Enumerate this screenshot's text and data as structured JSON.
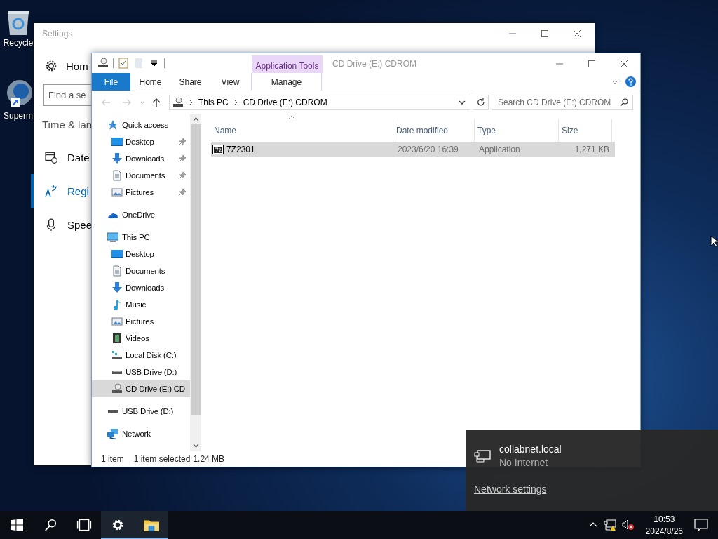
{
  "desktop_icons": [
    {
      "label": "Recycle",
      "kind": "recycle"
    },
    {
      "label": "Superm",
      "kind": "app"
    }
  ],
  "settings": {
    "title": "Settings",
    "home": "Hom",
    "search": {
      "placeholder": "Find a se"
    },
    "section": "Time & lan",
    "items": [
      {
        "label": "Date",
        "kind": "date",
        "selected": false
      },
      {
        "label": "Regi",
        "kind": "region",
        "selected": true
      },
      {
        "label": "Spee",
        "kind": "speech",
        "selected": false
      }
    ]
  },
  "explorer": {
    "title": "CD Drive (E:) CDROM",
    "context_group": "Application Tools",
    "tabs": [
      {
        "label": "File",
        "kind": "file"
      },
      {
        "label": "Home",
        "kind": "tab"
      },
      {
        "label": "Share",
        "kind": "tab"
      },
      {
        "label": "View",
        "kind": "tab"
      },
      {
        "label": "Manage",
        "kind": "context"
      }
    ],
    "address": [
      "This PC",
      "CD Drive (E:) CDROM"
    ],
    "search": {
      "placeholder": "Search CD Drive (E:) CDROM"
    },
    "nav": [
      {
        "label": "Quick access",
        "kind": "star",
        "selected": false,
        "children": [
          {
            "label": "Desktop",
            "kind": "desktop",
            "pinned": true,
            "selected": false
          },
          {
            "label": "Downloads",
            "kind": "downloads",
            "pinned": true,
            "selected": false
          },
          {
            "label": "Documents",
            "kind": "documents",
            "pinned": true,
            "selected": false
          },
          {
            "label": "Pictures",
            "kind": "pictures",
            "pinned": true,
            "selected": false
          }
        ]
      },
      {
        "label": "OneDrive",
        "kind": "cloud",
        "selected": false
      },
      {
        "label": "This PC",
        "kind": "pc",
        "selected": false,
        "children": [
          {
            "label": "Desktop",
            "kind": "desktop",
            "pinned": false,
            "selected": false
          },
          {
            "label": "Documents",
            "kind": "documents",
            "pinned": false,
            "selected": false
          },
          {
            "label": "Downloads",
            "kind": "downloads",
            "pinned": false,
            "selected": false
          },
          {
            "label": "Music",
            "kind": "music",
            "pinned": false,
            "selected": false
          },
          {
            "label": "Pictures",
            "kind": "pictures",
            "pinned": false,
            "selected": false
          },
          {
            "label": "Videos",
            "kind": "videos",
            "pinned": false,
            "selected": false
          },
          {
            "label": "Local Disk (C:)",
            "kind": "disk",
            "pinned": false,
            "selected": false
          },
          {
            "label": "USB Drive (D:)",
            "kind": "drive",
            "pinned": false,
            "selected": false
          },
          {
            "label": "CD Drive (E:) CD",
            "kind": "cd",
            "pinned": false,
            "selected": true
          }
        ]
      },
      {
        "label": "USB Drive (D:)",
        "kind": "drive",
        "selected": false
      },
      {
        "label": "Network",
        "kind": "network",
        "selected": false
      }
    ],
    "columns": [
      "Name",
      "Date modified",
      "Type",
      "Size"
    ],
    "files": [
      {
        "name": "7Z2301",
        "date": "2023/6/20 16:39",
        "type": "Application",
        "size": "1,271 KB",
        "selected": true
      }
    ],
    "status_bar": {
      "count": "1 item",
      "selection": "1 item selected",
      "size": "1.24 MB"
    }
  },
  "network_flyout": {
    "network": "collabnet.local",
    "status": "No Internet",
    "link": "Network settings"
  },
  "taskbar": {
    "buttons": [
      {
        "kind": "start",
        "running": false
      },
      {
        "kind": "search",
        "running": false
      },
      {
        "kind": "taskview",
        "running": false
      },
      {
        "kind": "settings",
        "running": true
      },
      {
        "kind": "explorer",
        "running": true
      }
    ],
    "time": "10:53",
    "date": "2024/8/26"
  }
}
